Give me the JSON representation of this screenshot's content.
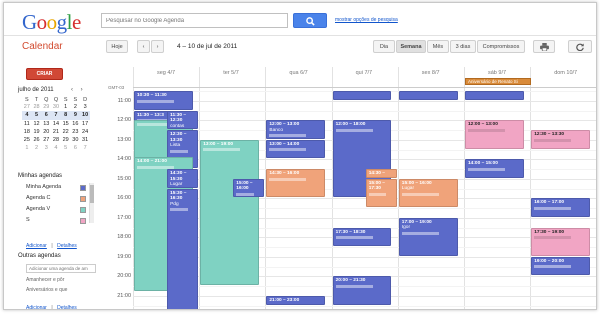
{
  "colors": {
    "blue": "#5b6ac9",
    "teal": "#7fd2c2",
    "orange": "#f0a37a",
    "pink": "#f1a5c4",
    "create": "#d14836",
    "allday": "#d98b3a"
  },
  "logo": {
    "letters": [
      "G",
      "o",
      "o",
      "g",
      "l",
      "e"
    ]
  },
  "search": {
    "placeholder": "Pesquisar no Google Agenda",
    "options_link": "mostrar opções de pesquisa",
    "icon": "search-icon"
  },
  "app": {
    "title": "Calendar"
  },
  "toolbar": {
    "today": "Hoje",
    "prev": "‹",
    "next": "›",
    "date_range": "4 – 10 de jul de 2011",
    "views": [
      "Dia",
      "Semana",
      "Mês",
      "3 dias",
      "Compromissos"
    ],
    "active_view": "Semana",
    "print_icon": "printer-icon",
    "refresh_icon": "refresh-icon"
  },
  "sidebar": {
    "create": "CRIAR",
    "mini_title": "julho de 2011",
    "mini_nav": "‹ ›",
    "weekdays": [
      "S",
      "T",
      "Q",
      "Q",
      "S",
      "S",
      "D"
    ],
    "weeks": [
      [
        "27",
        "28",
        "29",
        "30",
        "1",
        "2",
        "3"
      ],
      [
        "4",
        "5",
        "6",
        "7",
        "8",
        "9",
        "10"
      ],
      [
        "11",
        "12",
        "13",
        "14",
        "15",
        "16",
        "17"
      ],
      [
        "18",
        "19",
        "20",
        "21",
        "22",
        "23",
        "24"
      ],
      [
        "25",
        "26",
        "27",
        "28",
        "29",
        "30",
        "31"
      ],
      [
        "1",
        "2",
        "3",
        "4",
        "5",
        "6",
        "7"
      ]
    ],
    "my_calendars_title": "Minhas agendas",
    "my_calendars": [
      {
        "name": "Minha Agenda",
        "color": "#5b6ac9"
      },
      {
        "name": "Agenda C",
        "color": "#f0a37a"
      },
      {
        "name": "Agenda V",
        "color": "#7fd2c2"
      },
      {
        "name": "S",
        "color": "#f1a5c4"
      }
    ],
    "links": {
      "add": "Adicionar",
      "details": "Detalhes",
      "separator": "|"
    },
    "other_title": "Outras agendas",
    "other_placeholder": "Adicionar uma agenda de am",
    "other_items": [
      "Amanhecer e pôr",
      "Aniversários e que"
    ]
  },
  "grid": {
    "gmt": "GMT-03",
    "days": [
      "seg 4/7",
      "ter 5/7",
      "qua 6/7",
      "qui 7/7",
      "sex 8/7",
      "sáb 9/7",
      "dom 10/7"
    ],
    "hours": [
      "11:00",
      "12:00",
      "13:00",
      "14:00",
      "15:00",
      "16:00",
      "17:00",
      "18:00",
      "19:00",
      "20:00",
      "21:00"
    ],
    "allday_event": "Aniversário de Renato Si",
    "events": [
      {
        "day": 0,
        "start": 10.5,
        "end": 11.5,
        "color": "blue",
        "time": "10:30 – 11:30",
        "title": ""
      },
      {
        "day": 0,
        "start": 11.5,
        "end": 13.5,
        "color": "blue",
        "time": "11:30 – 13:3",
        "title": ""
      },
      {
        "day": 0,
        "start": 12.0,
        "end": 14.0,
        "color": "teal",
        "time": "",
        "title": ""
      },
      {
        "day": 0,
        "start": 11.5,
        "end": 12.5,
        "color": "blue",
        "time": "11:30 – 12:30",
        "title": "contas",
        "left": 0.5
      },
      {
        "day": 0,
        "start": 12.5,
        "end": 14.5,
        "color": "blue",
        "time": "12:30 – 13:30",
        "title": "Lista",
        "left": 0.5
      },
      {
        "day": 0,
        "start": 13.9,
        "end": 20.8,
        "color": "teal",
        "time": "14:00 – 21:00",
        "title": ""
      },
      {
        "day": 0,
        "start": 14.5,
        "end": 15.5,
        "color": "blue",
        "time": "14:30 – 15:30",
        "title": "Lugar",
        "left": 0.5
      },
      {
        "day": 0,
        "start": 15.5,
        "end": 22.0,
        "color": "blue",
        "time": "15:30 – 16:30",
        "title": "Pdg",
        "left": 0.5
      },
      {
        "day": 1,
        "start": 13.0,
        "end": 20.5,
        "color": "teal",
        "time": "13:00 – 19:00",
        "title": ""
      },
      {
        "day": 1,
        "start": 15.0,
        "end": 16.0,
        "color": "blue",
        "time": "15:00 – 16:00",
        "title": "",
        "left": 0.5
      },
      {
        "day": 2,
        "start": 12.0,
        "end": 13.0,
        "color": "blue",
        "time": "12:00 – 13:00",
        "title": "Banco"
      },
      {
        "day": 2,
        "start": 13.0,
        "end": 14.0,
        "color": "blue",
        "time": "13:00 – 14:00",
        "title": ""
      },
      {
        "day": 2,
        "start": 14.5,
        "end": 16.0,
        "color": "orange",
        "time": "14:30 – 16:00",
        "title": ""
      },
      {
        "day": 2,
        "start": 21.0,
        "end": 21.5,
        "color": "blue",
        "time": "21:00 – 23:00",
        "title": ""
      },
      {
        "day": 3,
        "start": 10.5,
        "end": 11.0,
        "color": "blue",
        "time": "",
        "title": ""
      },
      {
        "day": 3,
        "start": 12.0,
        "end": 16.0,
        "color": "blue",
        "time": "12:00 – 18:00",
        "title": ""
      },
      {
        "day": 3,
        "start": 14.5,
        "end": 15.0,
        "color": "orange",
        "time": "14:30 – 15:30",
        "title": "",
        "left": 0.5
      },
      {
        "day": 3,
        "start": 15.0,
        "end": 16.5,
        "color": "orange",
        "time": "15:00 – 17:30",
        "title": "",
        "left": 0.5
      },
      {
        "day": 3,
        "start": 17.5,
        "end": 18.5,
        "color": "blue",
        "time": "17:30 – 18:30",
        "title": ""
      },
      {
        "day": 3,
        "start": 20.0,
        "end": 21.5,
        "color": "blue",
        "time": "20:00 – 21:30",
        "title": ""
      },
      {
        "day": 4,
        "start": 10.5,
        "end": 11.0,
        "color": "blue",
        "time": "",
        "title": ""
      },
      {
        "day": 4,
        "start": 15.0,
        "end": 16.5,
        "color": "orange",
        "time": "15:00 – 16:00",
        "title": "Lugar"
      },
      {
        "day": 4,
        "start": 17.0,
        "end": 19.0,
        "color": "blue",
        "time": "17:00 – 19:00",
        "title": "Igor"
      },
      {
        "day": 5,
        "start": 10.5,
        "end": 11.0,
        "color": "blue",
        "time": "",
        "title": ""
      },
      {
        "day": 5,
        "start": 12.0,
        "end": 13.5,
        "color": "pink",
        "time": "12:00 – 13:00",
        "title": ""
      },
      {
        "day": 5,
        "start": 14.0,
        "end": 15.0,
        "color": "blue",
        "time": "14:00 – 15:00",
        "title": ""
      },
      {
        "day": 6,
        "start": 12.5,
        "end": 13.5,
        "color": "pink",
        "time": "12:30 – 13:30",
        "title": ""
      },
      {
        "day": 6,
        "start": 16.0,
        "end": 17.0,
        "color": "blue",
        "time": "16:00 – 17:00",
        "title": ""
      },
      {
        "day": 6,
        "start": 17.5,
        "end": 19.0,
        "color": "pink",
        "time": "17:30 – 19:00",
        "title": ""
      },
      {
        "day": 6,
        "start": 19.0,
        "end": 20.0,
        "color": "blue",
        "time": "19:00 – 20:00",
        "title": ""
      }
    ]
  }
}
